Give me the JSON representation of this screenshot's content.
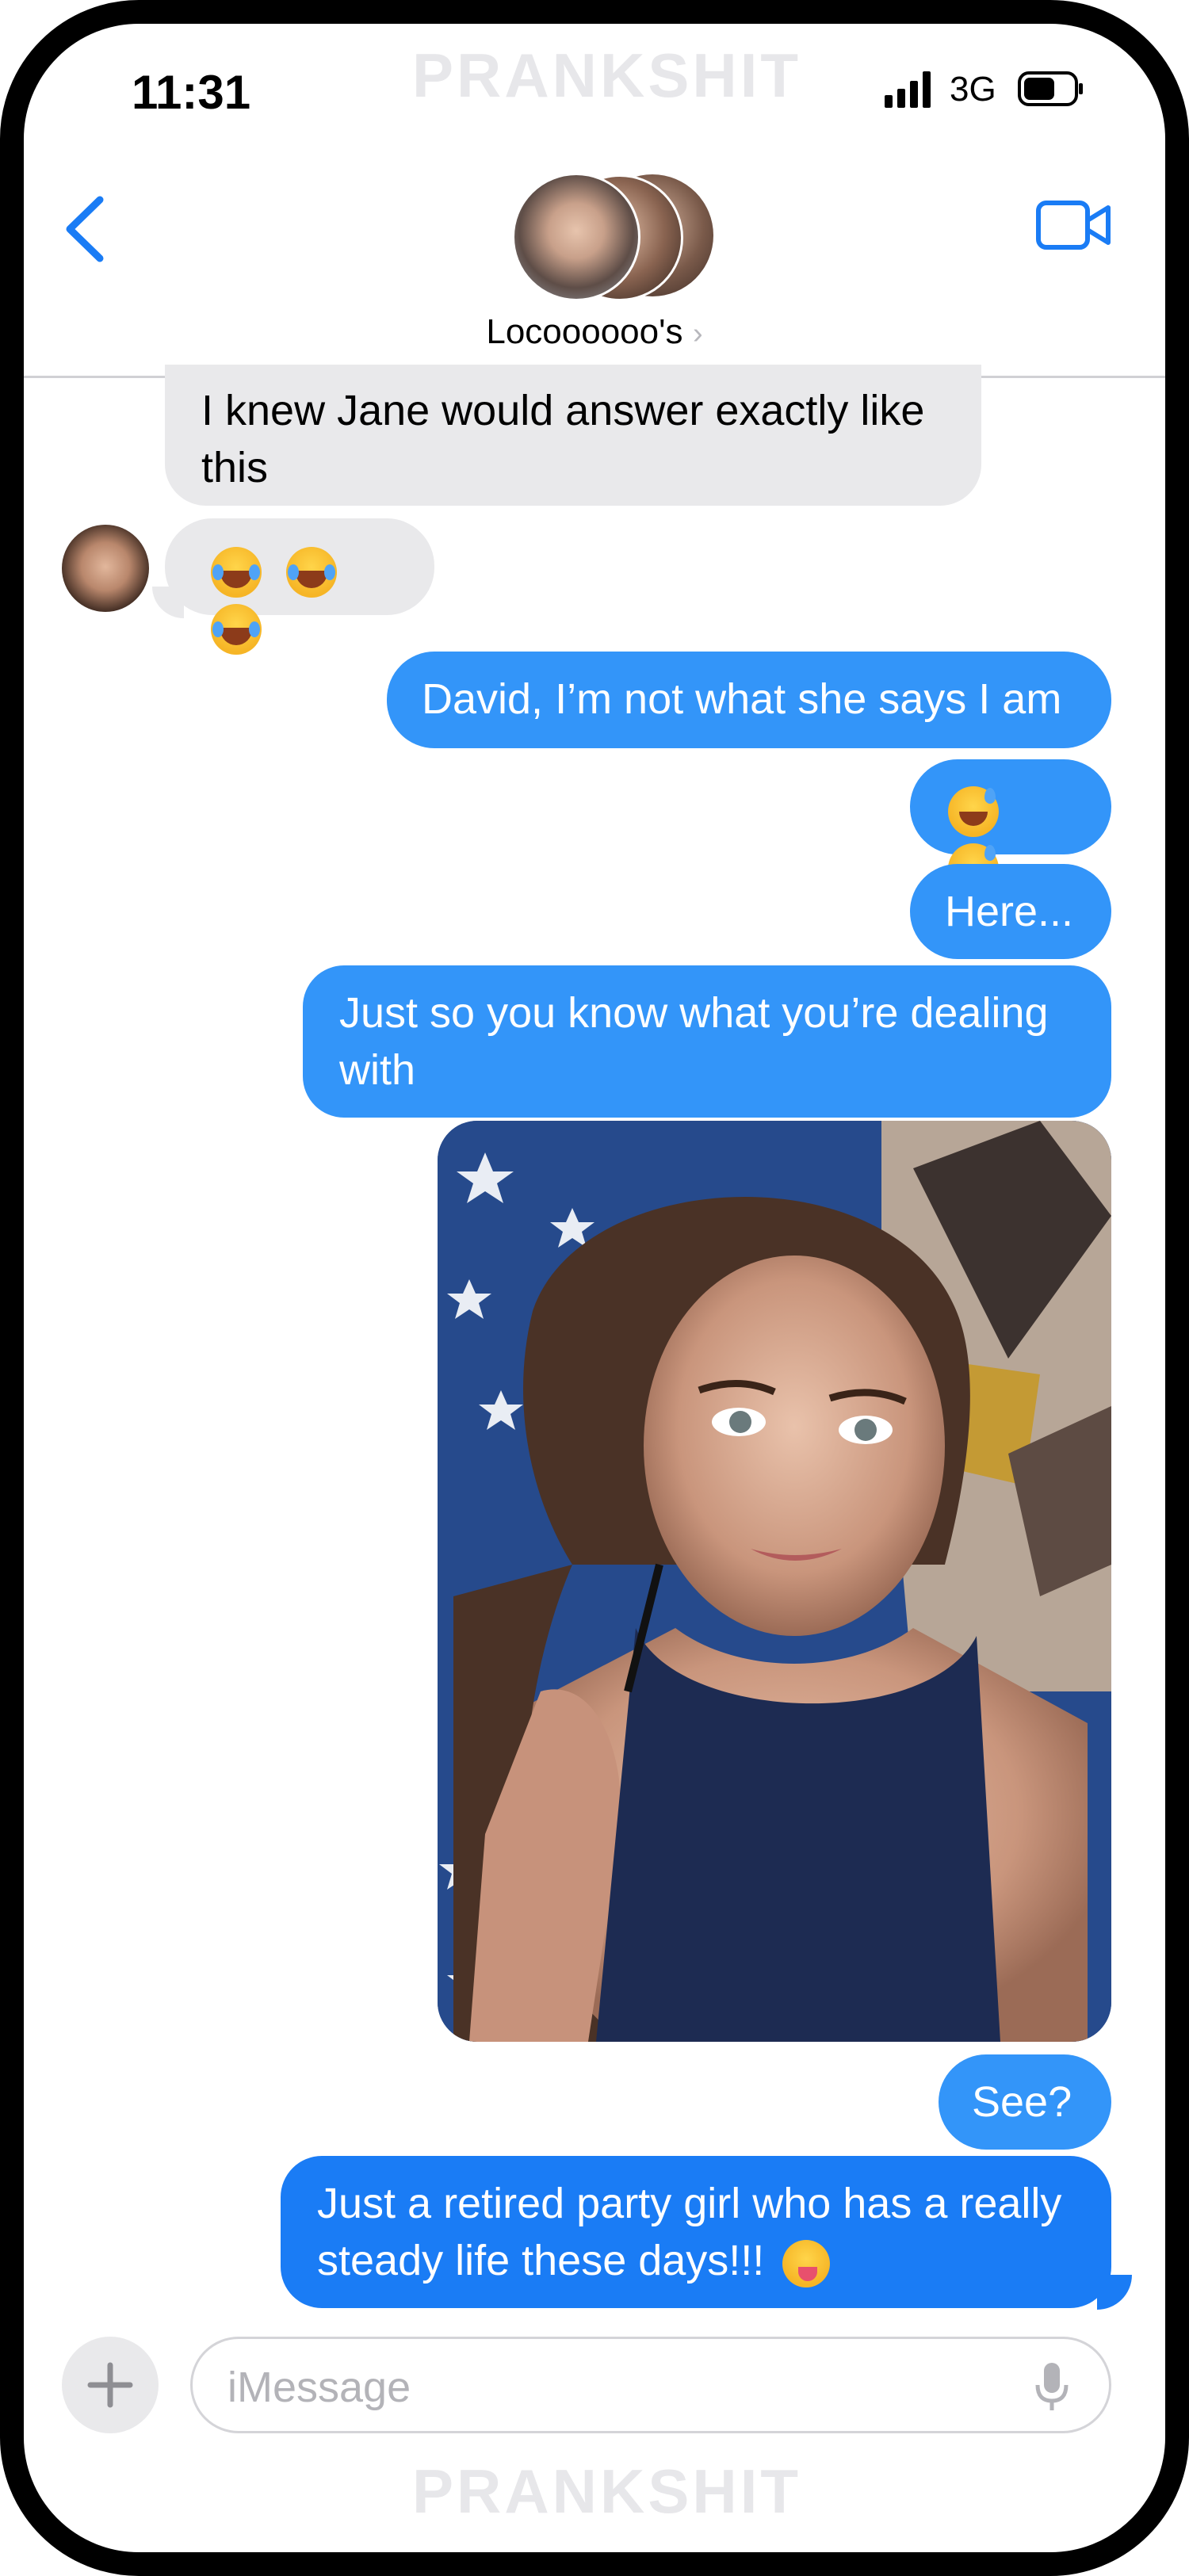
{
  "status_bar": {
    "time": "11:31",
    "network": "3G"
  },
  "watermark": {
    "top": "PRANKSHIT",
    "bottom": "PRANKSHIT"
  },
  "header": {
    "contact_name": "Locoooooo's",
    "chevron": "›"
  },
  "messages": [
    {
      "direction": "incoming",
      "text": "I knew Jane would answer exactly like this"
    },
    {
      "direction": "incoming",
      "emoji": [
        "face-with-tears-of-joy",
        "face-with-tears-of-joy",
        "face-with-tears-of-joy"
      ]
    },
    {
      "direction": "outgoing",
      "text": "David, I’m not what she says I am"
    },
    {
      "direction": "outgoing",
      "emoji": [
        "grinning-face-with-sweat",
        "grinning-face-with-sweat"
      ]
    },
    {
      "direction": "outgoing",
      "text": "Here..."
    },
    {
      "direction": "outgoing",
      "text": "Just so you know what you’re dealing with"
    },
    {
      "direction": "outgoing",
      "type": "photo"
    },
    {
      "direction": "outgoing",
      "text": "See?"
    },
    {
      "direction": "outgoing",
      "text": "Just a retired party girl who has a really steady life these days!!!",
      "emoji": [
        "zany-face"
      ]
    }
  ],
  "composer": {
    "placeholder": "iMessage",
    "add_icon": "plus-icon",
    "mic_icon": "microphone-icon"
  },
  "colors": {
    "outgoing_bubble": "#3395f9",
    "incoming_bubble": "#e9e9eb",
    "accent": "#1a7cf5"
  }
}
